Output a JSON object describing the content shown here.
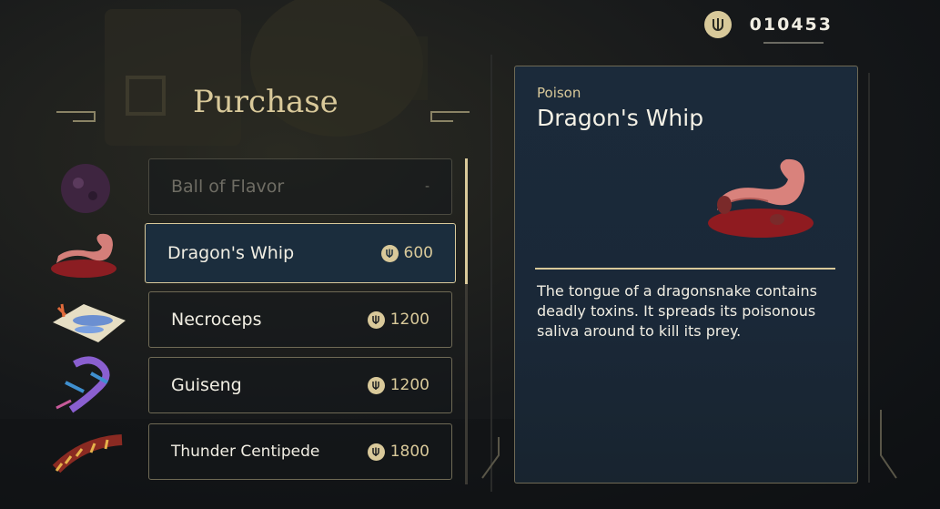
{
  "header": {
    "title": "Purchase",
    "balance": "010453",
    "currency_icon": "coin-icon"
  },
  "shop": {
    "items": [
      {
        "name": "Ball of Flavor",
        "price": "-",
        "state": "unavailable",
        "icon": "ball-of-flavor-icon"
      },
      {
        "name": "Dragon's Whip",
        "price": "600",
        "state": "selected",
        "icon": "dragons-whip-icon"
      },
      {
        "name": "Necroceps",
        "price": "1200",
        "state": "normal",
        "icon": "necroceps-icon"
      },
      {
        "name": "Guiseng",
        "price": "1200",
        "state": "normal",
        "icon": "guiseng-icon"
      },
      {
        "name": "Thunder Centipede",
        "price": "1800",
        "state": "normal",
        "icon": "thunder-centipede-icon"
      }
    ]
  },
  "detail": {
    "category": "Poison",
    "name": "Dragon's Whip",
    "description": "The tongue of a dragonsnake contains deadly toxins. It spreads its poisonous saliva around to kill its prey."
  },
  "colors": {
    "accent": "#d9c99a",
    "panel": "#1b2a3a",
    "selected_bg": "#1b2d3d"
  }
}
